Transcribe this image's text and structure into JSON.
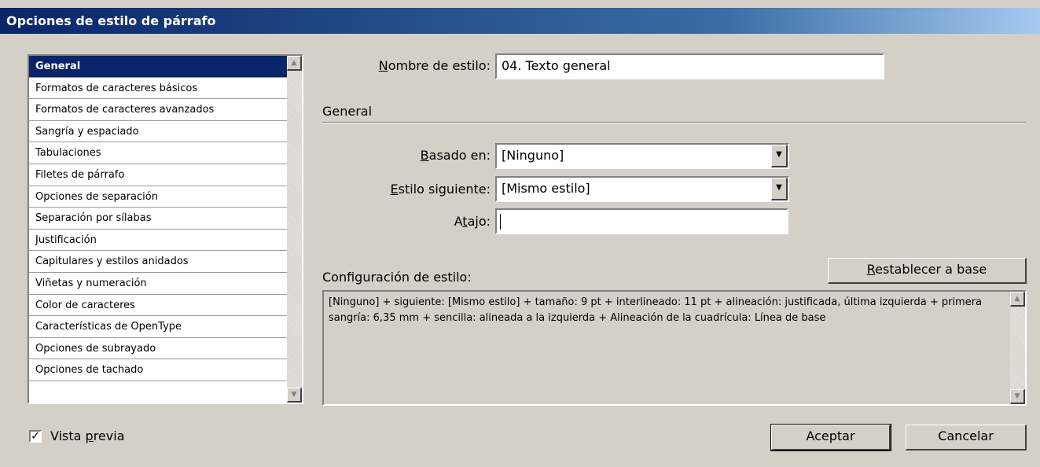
{
  "window": {
    "title": "Opciones de estilo de párrafo"
  },
  "categories": [
    {
      "label": "General",
      "selected": true
    },
    {
      "label": "Formatos de caracteres básicos"
    },
    {
      "label": "Formatos de caracteres avanzados"
    },
    {
      "label": "Sangría y espaciado"
    },
    {
      "label": "Tabulaciones"
    },
    {
      "label": "Filetes de párrafo"
    },
    {
      "label": "Opciones de separación"
    },
    {
      "label": "Separación por sílabas"
    },
    {
      "label": "Justificación"
    },
    {
      "label": "Capitulares y estilos anidados"
    },
    {
      "label": "Viñetas y numeración"
    },
    {
      "label": "Color de caracteres"
    },
    {
      "label": "Características de OpenType"
    },
    {
      "label": "Opciones de subrayado"
    },
    {
      "label": "Opciones de tachado"
    }
  ],
  "style_name": {
    "label_pre": "",
    "label_u": "N",
    "label_post": "ombre de estilo:",
    "value": "04. Texto general"
  },
  "general_section": {
    "title": "General"
  },
  "based_on": {
    "label_u": "B",
    "label_post": "asado en:",
    "value": "[Ninguno]"
  },
  "next_style": {
    "label_u": "E",
    "label_post": "stilo siguiente:",
    "value": "[Mismo estilo]"
  },
  "shortcut": {
    "label_pre": "A",
    "label_u": "t",
    "label_post": "ajo:",
    "value": ""
  },
  "style_settings": {
    "label": "Configuración de estilo:",
    "reset_u": "R",
    "reset_post": "establecer a base",
    "text": "[Ninguno]  + siguiente:  [Mismo estilo] + tamaño:  9 pt + interlineado:  11 pt + alineación: justificada, última izquierda + primera sangría: 6,35 mm + sencilla: alineada a la izquierda + Alineación de la cuadrícula:  Línea de base"
  },
  "preview": {
    "checked": true,
    "label_pre": "Vista ",
    "label_u": "p",
    "label_post": "revia"
  },
  "buttons": {
    "ok": "Aceptar",
    "cancel": "Cancelar"
  },
  "icons": {
    "scroll_up": "triangle-up",
    "scroll_down": "triangle-down",
    "dropdown": "triangle-down",
    "check": "checkmark"
  }
}
